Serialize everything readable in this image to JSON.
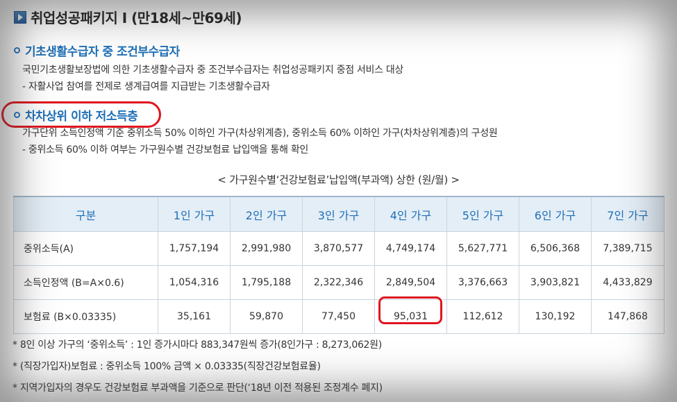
{
  "title": "취업성공패키지 I (만18세~만69세)",
  "sections": [
    {
      "title": "기초생활수급자 중 조건부수급자",
      "lines": [
        "국민기초생활보장법에 의한 기초생활수급자 중 조건부수급자는 취업성공패키지 중점 서비스 대상",
        "- 자활사업 참여를 전제로 생계급여를 지급받는 기초생활수급자"
      ]
    },
    {
      "title": "차차상위 이하 저소득층",
      "lines": [
        "가구단위 소득인정액 기준 중위소득 50% 이하인 가구(차상위계층), 중위소득 60% 이하인 가구(차차상위계층)의 구성원",
        "- 중위소득 60% 이하 여부는 가구원수별 건강보험료 납입액을 통해 확인"
      ]
    }
  ],
  "table": {
    "caption": "< 가구원수별‘건강보험료’납입액(부과액) 상한 (원/월) >",
    "headers": [
      "구분",
      "1인 가구",
      "2인 가구",
      "3인 가구",
      "4인 가구",
      "5인 가구",
      "6인 가구",
      "7인 가구"
    ],
    "rows": [
      [
        "중위소득(A)",
        "1,757,194",
        "2,991,980",
        "3,870,577",
        "4,749,174",
        "5,627,771",
        "6,506,368",
        "7,389,715"
      ],
      [
        "소득인정액 (B=A×0.6)",
        "1,054,316",
        "1,795,188",
        "2,322,346",
        "2,849,504",
        "3,376,663",
        "3,903,821",
        "4,433,829"
      ],
      [
        "보험료 (B×0.03335)",
        "35,161",
        "59,870",
        "77,450",
        "95,031",
        "112,612",
        "130,192",
        "147,868"
      ]
    ]
  },
  "notes": [
    "* 8인 이상 가구의 ‘중위소득’ : 1인 증가시마다 883,347원씩 증가(8인가구 : 8,273,062원)",
    "* (직장가입자)보험료 : 중위소득 100% 금액 × 0.03335(직장건강보험료율)",
    "* 지역가입자의 경우도 건강보험료 부과액을 기준으로 판단(‘18년 이전 적용된 조정계수 폐지)"
  ],
  "colors": {
    "accent": "#1e6fb6",
    "highlight_circle": "#e0141d",
    "header_bg": "#e4eef7"
  }
}
